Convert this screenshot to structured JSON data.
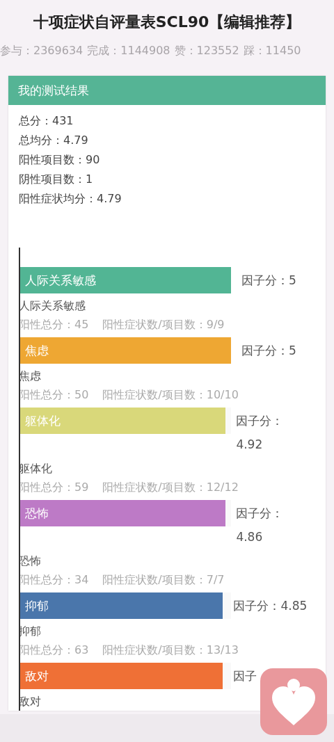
{
  "title": "十项症状自评量表SCL90【编辑推荐】",
  "stats": [
    "参与：2369634",
    "完成：1144908",
    "赞：123552",
    "踩：11450"
  ],
  "result": {
    "heading": "我的测试结果",
    "summary": [
      "总分：431",
      "总均分：4.79",
      "阳性项目数：90",
      "阴性项目数：1",
      "阳性症状均分：4.79"
    ],
    "factors": [
      {
        "name": "人际关系敏感",
        "color": "#52b594",
        "level": 1,
        "score": "因子分：5",
        "caption": "人际关系敏感",
        "positive_total": "阳性总分：45",
        "ratio": "阳性症状数/项目数：9/9"
      },
      {
        "name": "焦虑",
        "color": "#eea733",
        "level": 1,
        "score": "因子分：5",
        "caption": "焦虑",
        "positive_total": "阳性总分：50",
        "ratio": "阳性症状数/项目数：10/10"
      },
      {
        "name": "躯体化",
        "color": "#d9d87a",
        "level": 0.975,
        "score": "因子分：4.92",
        "caption": "躯体化",
        "positive_total": "阳性总分：59",
        "ratio": "阳性症状数/项目数：12/12"
      },
      {
        "name": "恐怖",
        "color": "#bd7ac6",
        "level": 0.975,
        "score": "因子分：4.86",
        "caption": "恐怖",
        "positive_total": "阳性总分：34",
        "ratio": "阳性症状数/项目数：7/7"
      },
      {
        "name": "抑郁",
        "color": "#4a76ab",
        "level": 0.962,
        "score": "因子分：4.85",
        "caption": "抑郁",
        "positive_total": "阳性总分：63",
        "ratio": "阳性症状数/项目数：13/13"
      },
      {
        "name": "敌对",
        "color": "#ef7036",
        "level": 0.962,
        "score": "因子",
        "caption": "敌对"
      }
    ]
  }
}
